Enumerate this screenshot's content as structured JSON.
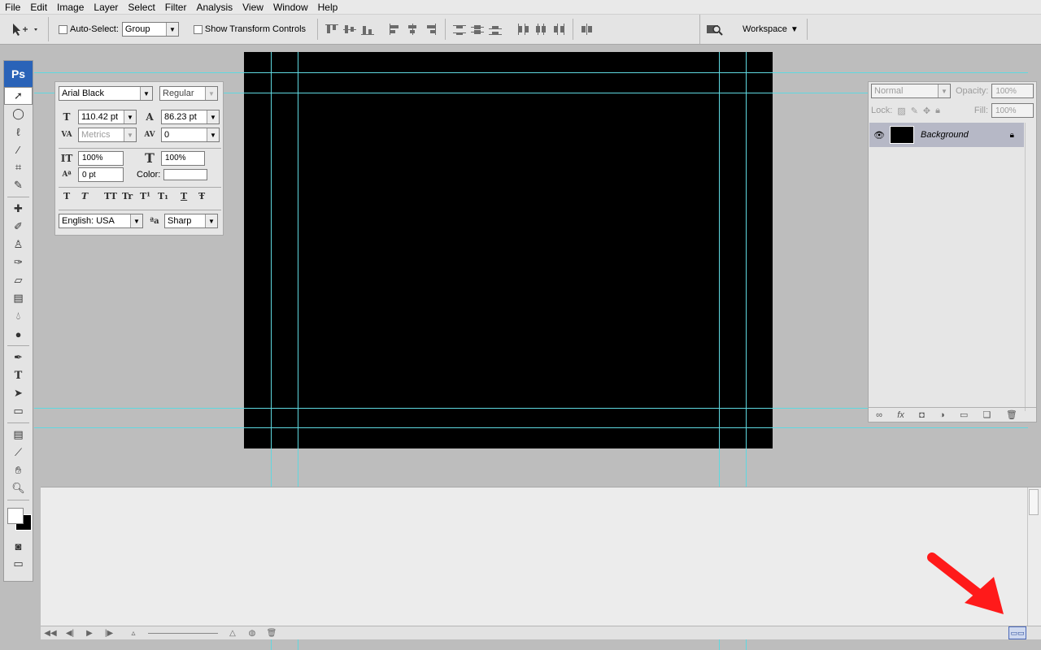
{
  "menu": [
    "File",
    "Edit",
    "Image",
    "Layer",
    "Select",
    "Filter",
    "Analysis",
    "View",
    "Window",
    "Help"
  ],
  "options": {
    "auto_select_label": "Auto-Select:",
    "auto_select_value": "Group",
    "show_transform_label": "Show Transform Controls",
    "workspace_label": "Workspace"
  },
  "toolbox": {
    "logo": "Ps"
  },
  "character": {
    "font_family": "Arial Black",
    "font_style": "Regular",
    "font_size": "110.42 pt",
    "leading": "86.23 pt",
    "kerning": "Metrics",
    "tracking": "0",
    "vertical_scale": "100%",
    "horizontal_scale": "100%",
    "baseline_shift": "0 pt",
    "color_label": "Color:",
    "language": "English: USA",
    "antialias": "Sharp",
    "style_buttons": [
      "T",
      "T",
      "TT",
      "Tr",
      "T¹",
      "T₁",
      "T",
      "Ŧ"
    ]
  },
  "layers": {
    "blend_mode": "Normal",
    "opacity_label": "Opacity:",
    "opacity_value": "100%",
    "lock_label": "Lock:",
    "fill_label": "Fill:",
    "fill_value": "100%",
    "layer_name": "Background"
  },
  "colors": {
    "guide": "#5fd8e0",
    "canvas": "#000000",
    "accent_arrow": "#ff1a1a",
    "ps_logo": "#2a63b8"
  }
}
